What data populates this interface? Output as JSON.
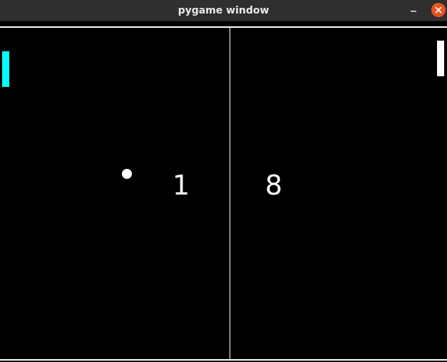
{
  "window": {
    "title": "pygame window",
    "minimize_icon": "minimize-icon",
    "close_icon": "close-icon",
    "close_color": "#e95420"
  },
  "game": {
    "background_color": "#000000",
    "left_paddle_color": "#00ffff",
    "right_paddle_color": "#ffffff",
    "ball_color": "#ffffff",
    "score_left": "1",
    "score_right": "8"
  }
}
